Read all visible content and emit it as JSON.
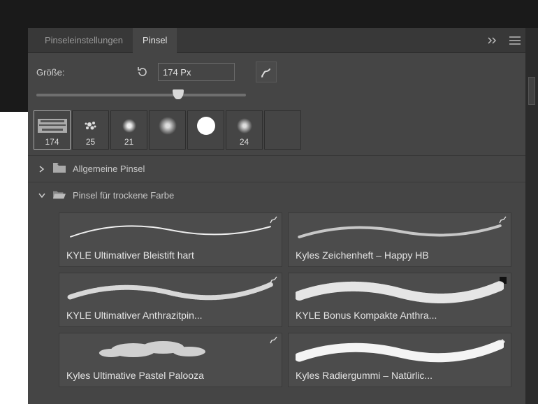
{
  "tabs": {
    "settings_label": "Pinseleinstellungen",
    "brushes_label": "Pinsel"
  },
  "size": {
    "label": "Größe:",
    "value": "174 Px"
  },
  "recents": [
    {
      "label": "174",
      "type": "texture"
    },
    {
      "label": "25",
      "type": "splat"
    },
    {
      "label": "21",
      "type": "soft"
    },
    {
      "label": "",
      "type": "soft"
    },
    {
      "label": "",
      "type": "hard"
    },
    {
      "label": "24",
      "type": "soft"
    },
    {
      "label": "",
      "type": "empty"
    }
  ],
  "groups": [
    {
      "expanded": false,
      "label": "Allgemeine Pinsel"
    },
    {
      "expanded": true,
      "label": "Pinsel für trockene Farbe"
    }
  ],
  "brushes": [
    {
      "label": "KYLE Ultimativer Bleistift hart",
      "variant": "thin",
      "corner": "brush"
    },
    {
      "label": "Kyles Zeichenheft – Happy HB",
      "variant": "grain",
      "corner": "brush"
    },
    {
      "label": "KYLE Ultimativer Anthrazitpin...",
      "variant": "grain2",
      "corner": "brush"
    },
    {
      "label": "KYLE Bonus Kompakte Anthra...",
      "variant": "heavy",
      "corner": "square"
    },
    {
      "label": "Kyles Ultimative Pastel Palooza",
      "variant": "cloud",
      "corner": "brush"
    },
    {
      "label": "Kyles Radiergummi – Natürlic...",
      "variant": "thick",
      "corner": "eraser"
    }
  ]
}
